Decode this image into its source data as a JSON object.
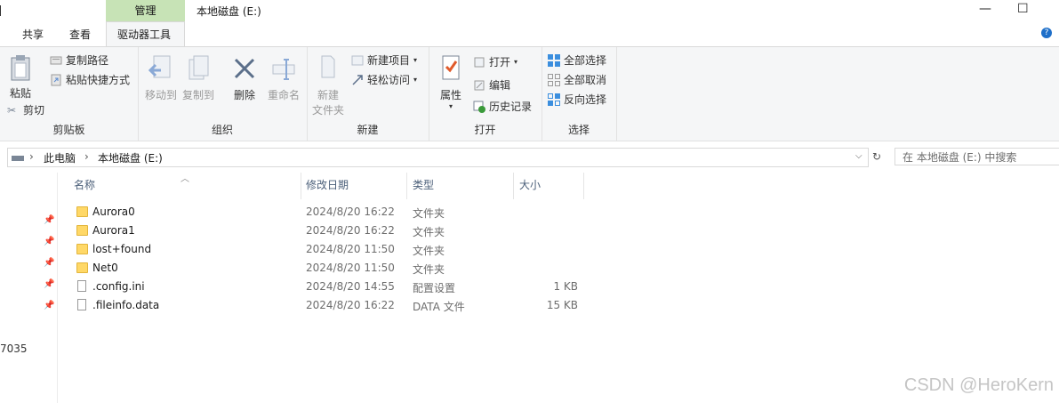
{
  "title_bar": {
    "context_tab": "管理",
    "title": "本地磁盘 (E:)",
    "minimize": "—",
    "maximize": "☐"
  },
  "tabs": [
    "共享",
    "查看",
    "驱动器工具"
  ],
  "ribbon": {
    "clipboard": {
      "label": "剪贴板",
      "paste": "粘贴",
      "cut": "剪切",
      "copy_path": "复制路径",
      "paste_shortcut": "粘贴快捷方式"
    },
    "organize": {
      "label": "组织",
      "move_to": "移动到",
      "copy_to": "复制到",
      "delete": "删除",
      "rename": "重命名"
    },
    "new": {
      "label": "新建",
      "new_folder_line1": "新建",
      "new_folder_line2": "文件夹",
      "new_item": "新建项目",
      "easy_access": "轻松访问"
    },
    "open": {
      "label": "打开",
      "properties": "属性",
      "open": "打开",
      "edit": "编辑",
      "history": "历史记录"
    },
    "select": {
      "label": "选择",
      "select_all": "全部选择",
      "select_none": "全部取消",
      "invert": "反向选择"
    }
  },
  "address": {
    "crumbs": [
      "此电脑",
      "本地磁盘 (E:)"
    ],
    "search_placeholder": "在 本地磁盘 (E:) 中搜索"
  },
  "columns": [
    "名称",
    "修改日期",
    "类型",
    "大小"
  ],
  "files": [
    {
      "name": "Aurora0",
      "date": "2024/8/20 16:22",
      "type": "文件夹",
      "size": "",
      "icon": "folder"
    },
    {
      "name": "Aurora1",
      "date": "2024/8/20 16:22",
      "type": "文件夹",
      "size": "",
      "icon": "folder"
    },
    {
      "name": "lost+found",
      "date": "2024/8/20 11:50",
      "type": "文件夹",
      "size": "",
      "icon": "folder"
    },
    {
      "name": "Net0",
      "date": "2024/8/20 11:50",
      "type": "文件夹",
      "size": "",
      "icon": "folder"
    },
    {
      "name": ".config.ini",
      "date": "2024/8/20 14:55",
      "type": "配置设置",
      "size": "1 KB",
      "icon": "ini-file"
    },
    {
      "name": ".fileinfo.data",
      "date": "2024/8/20 16:22",
      "type": "DATA 文件",
      "size": "15 KB",
      "icon": "file"
    }
  ],
  "side_text": "7035",
  "watermark": "CSDN @HeroKern"
}
